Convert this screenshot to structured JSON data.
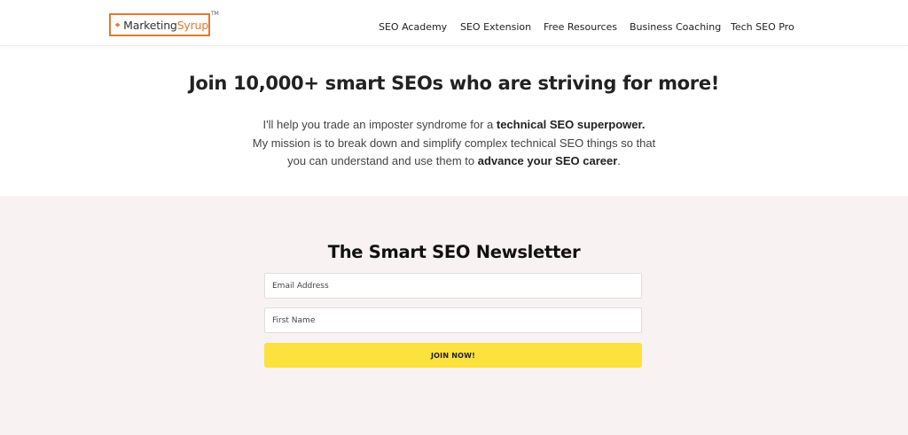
{
  "header": {
    "logo": {
      "text_part1": "Marketing",
      "text_part2": "Syrup",
      "trademark": "TM",
      "brand_color": "#e27a2e",
      "icon": "maple-leaf-icon"
    },
    "nav": [
      {
        "label": "SEO Academy"
      },
      {
        "label": "SEO Extension"
      },
      {
        "label": "Free Resources"
      },
      {
        "label": "Business Coaching"
      },
      {
        "label": "Tech SEO Pro"
      }
    ]
  },
  "hero": {
    "title": "Join 10,000+ smart SEOs who are striving for more!",
    "line1_pre": "I'll help you trade an imposter syndrome for a ",
    "line1_bold": "technical SEO superpower.",
    "line2": "My mission is to break down and simplify complex technical SEO things so that",
    "line3_pre": "you can understand and use them to ",
    "line3_bold": "advance your SEO career",
    "line3_post": "."
  },
  "newsletter": {
    "title": "The Smart SEO Newsletter",
    "email_placeholder": "Email Address",
    "first_name_placeholder": "First Name",
    "button_label": "JOIN NOW!",
    "button_color": "#fde13d",
    "section_bg": "#f8f3f2"
  }
}
